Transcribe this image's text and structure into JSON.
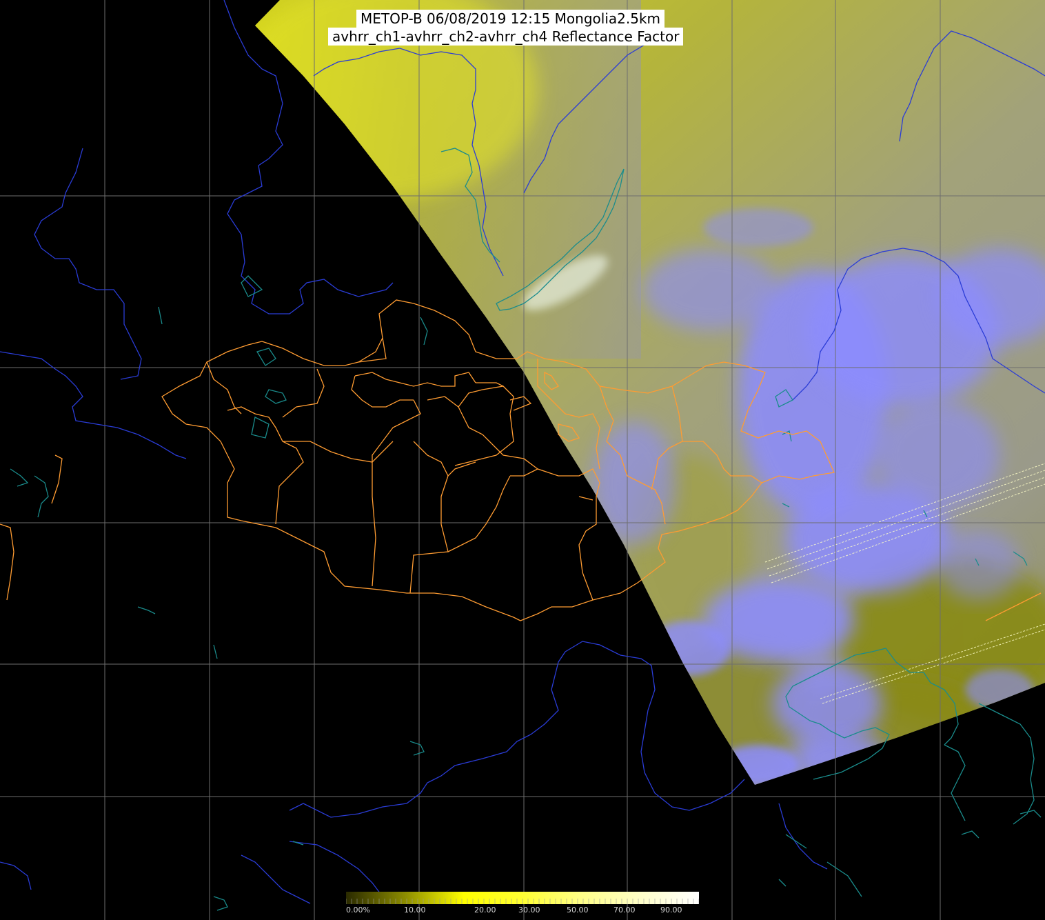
{
  "header": {
    "line1": "METOP-B 06/08/2019 12:15 Mongolia2.5km",
    "line2": "avhrr_ch1-avhrr_ch2-avhrr_ch4 Reflectance Factor"
  },
  "colorbar": {
    "labels": [
      "0.00%",
      "10.00",
      "20.00",
      "30.00",
      "50.00",
      "70.00",
      "90.00"
    ],
    "stops": [
      "#2a2a00",
      "#8c8c00",
      "#ffff00",
      "#ffff33",
      "#ffff88",
      "#ffffc8",
      "#ffffff"
    ]
  },
  "colors": {
    "background": "#000000",
    "swath_yellow": "#c8c81e",
    "swath_olive": "#8c8c28",
    "swath_gray": "#a0a0a0",
    "cloud_lavender": "#8c8cff",
    "border_orange": "#ff9c32",
    "river_blue": "#2a3cd6",
    "lake_teal": "#1a8c8c",
    "grid_gray": "#707070"
  }
}
